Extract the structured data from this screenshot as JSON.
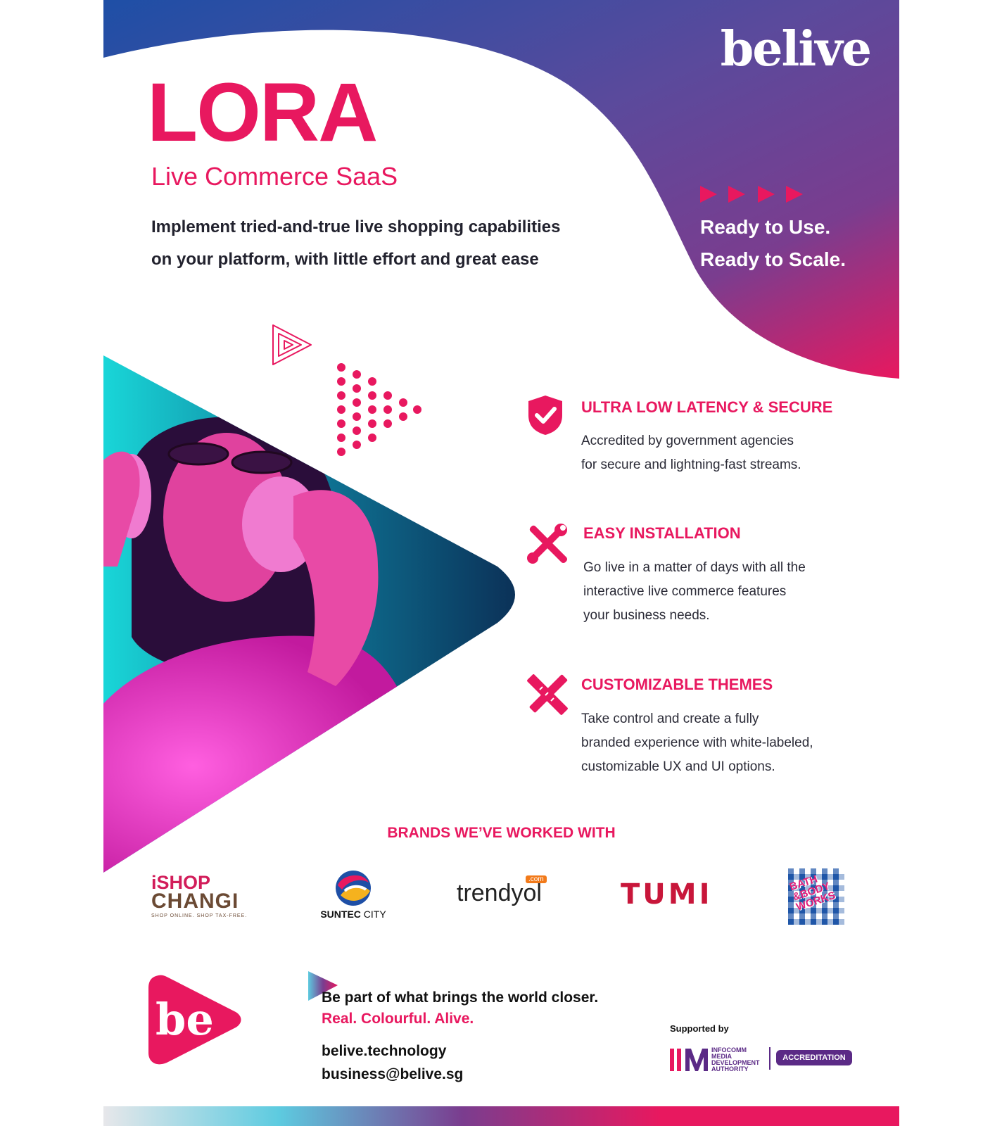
{
  "brand": {
    "name": "belive"
  },
  "hero": {
    "title": "LORA",
    "subtitle": "Live Commerce SaaS",
    "intro_line1": "Implement tried-and-true live shopping capabilities",
    "intro_line2": "on your platform, with little effort and great ease",
    "tagline_line1": "Ready to Use.",
    "tagline_line2": "Ready to Scale."
  },
  "features": [
    {
      "icon": "shield-check-icon",
      "title": "ULTRA LOW LATENCY & SECURE",
      "desc_line1": "Accredited by government agencies",
      "desc_line2": "for secure and lightning-fast streams."
    },
    {
      "icon": "tools-icon",
      "title": "EASY INSTALLATION",
      "desc_line1": "Go live in a matter of days with all the",
      "desc_line2": "interactive live commerce features",
      "desc_line3": "your business needs."
    },
    {
      "icon": "ruler-pencil-icon",
      "title": "CUSTOMIZABLE THEMES",
      "desc_line1": "Take control and create a fully",
      "desc_line2": "branded experience with white-labeled,",
      "desc_line3": "customizable UX and UI options."
    }
  ],
  "brands": {
    "heading": "BRANDS WE’VE WORKED WITH",
    "ishop": {
      "line1": "iSHOP",
      "line2": "CHANGI",
      "tag": "SHOP ONLINE. SHOP TAX-FREE."
    },
    "suntec": {
      "word1": "SUNTEC",
      "word2": "CITY"
    },
    "trendyol": {
      "name": "trendyol",
      "com": ".com"
    },
    "tumi": {
      "name": "TUMI"
    },
    "bbw": {
      "line1": "BATH",
      "line2": "&BODY",
      "line3": "WORKS"
    }
  },
  "footer": {
    "logo_text": "be",
    "line1": "Be part of what brings the world closer.",
    "line2": "Real. Colourful. Alive.",
    "website": "belive.technology",
    "email": "business@belive.sg",
    "supported_by": "Supported by",
    "imda_line1": "INFOCOMM",
    "imda_line2": "MEDIA",
    "imda_line3": "DEVELOPMENT",
    "imda_line4": "AUTHORITY",
    "accreditation": "ACCREDITATION"
  },
  "colors": {
    "accent": "#e8185f",
    "purple": "#5b2a86",
    "navy": "#1e4fa6"
  }
}
